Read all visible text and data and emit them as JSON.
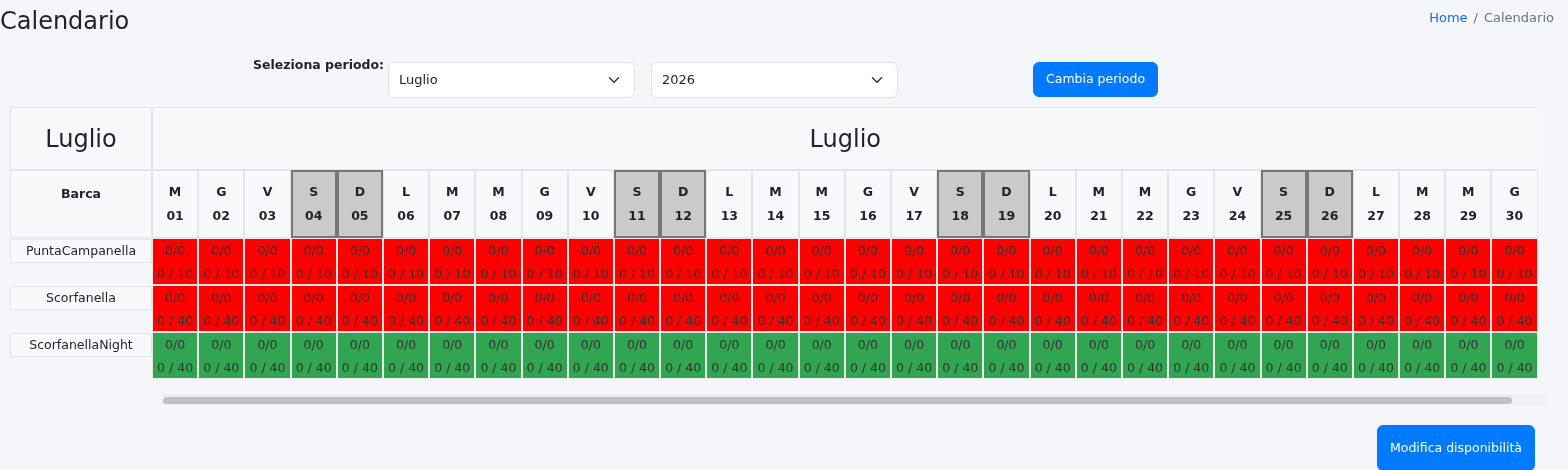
{
  "page_title": "Calendario",
  "breadcrumb": {
    "items": [
      {
        "label": "Home",
        "link": true
      },
      {
        "label": "Calendario",
        "link": false
      }
    ],
    "separator": "/"
  },
  "period": {
    "label": "Seleziona periodo:",
    "month": "Luglio",
    "year": "2026",
    "button": "Cambia periodo"
  },
  "calendar": {
    "corner_title": "Luglio",
    "month_title": "Luglio",
    "boat_header": "Barca",
    "days": [
      {
        "weekday": "M",
        "day": "01",
        "weekend": false
      },
      {
        "weekday": "G",
        "day": "02",
        "weekend": false
      },
      {
        "weekday": "V",
        "day": "03",
        "weekend": false
      },
      {
        "weekday": "S",
        "day": "04",
        "weekend": true
      },
      {
        "weekday": "D",
        "day": "05",
        "weekend": true
      },
      {
        "weekday": "L",
        "day": "06",
        "weekend": false
      },
      {
        "weekday": "M",
        "day": "07",
        "weekend": false
      },
      {
        "weekday": "M",
        "day": "08",
        "weekend": false
      },
      {
        "weekday": "G",
        "day": "09",
        "weekend": false
      },
      {
        "weekday": "V",
        "day": "10",
        "weekend": false
      },
      {
        "weekday": "S",
        "day": "11",
        "weekend": true
      },
      {
        "weekday": "D",
        "day": "12",
        "weekend": true
      },
      {
        "weekday": "L",
        "day": "13",
        "weekend": false
      },
      {
        "weekday": "M",
        "day": "14",
        "weekend": false
      },
      {
        "weekday": "M",
        "day": "15",
        "weekend": false
      },
      {
        "weekday": "G",
        "day": "16",
        "weekend": false
      },
      {
        "weekday": "V",
        "day": "17",
        "weekend": false
      },
      {
        "weekday": "S",
        "day": "18",
        "weekend": true
      },
      {
        "weekday": "D",
        "day": "19",
        "weekend": true
      },
      {
        "weekday": "L",
        "day": "20",
        "weekend": false
      },
      {
        "weekday": "M",
        "day": "21",
        "weekend": false
      },
      {
        "weekday": "M",
        "day": "22",
        "weekend": false
      },
      {
        "weekday": "G",
        "day": "23",
        "weekend": false
      },
      {
        "weekday": "V",
        "day": "24",
        "weekend": false
      },
      {
        "weekday": "S",
        "day": "25",
        "weekend": true
      },
      {
        "weekday": "D",
        "day": "26",
        "weekend": true
      },
      {
        "weekday": "L",
        "day": "27",
        "weekend": false
      },
      {
        "weekday": "M",
        "day": "28",
        "weekend": false
      },
      {
        "weekday": "M",
        "day": "29",
        "weekend": false
      },
      {
        "weekday": "G",
        "day": "30",
        "weekend": false
      }
    ],
    "boats": [
      {
        "name": "PuntaCampanella",
        "color": "#ff0000",
        "booked": [
          "0/0",
          "0/0",
          "0/0",
          "0/0",
          "0/0",
          "0/0",
          "0/0",
          "0/0",
          "0/0",
          "0/0",
          "0/0",
          "0/0",
          "0/0",
          "0/0",
          "0/0",
          "0/0",
          "0/0",
          "0/0",
          "0/0",
          "0/0",
          "0/0",
          "0/0",
          "0/0",
          "0/0",
          "0/0",
          "0/0",
          "0/0",
          "0/0",
          "0/0",
          "0/0"
        ],
        "capacity": [
          "0 / 10",
          "0 / 10",
          "0 / 10",
          "0 / 10",
          "0 / 10",
          "0 / 10",
          "0 / 10",
          "0 / 10",
          "0 / 10",
          "0 / 10",
          "0 / 10",
          "0 / 10",
          "0 / 10",
          "0 / 10",
          "0 / 10",
          "0 / 10",
          "0 / 10",
          "0 / 10",
          "0 / 10",
          "0 / 10",
          "0 / 10",
          "0 / 10",
          "0 / 10",
          "0 / 10",
          "0 / 10",
          "0 / 10",
          "0 / 10",
          "0 / 10",
          "0 / 10",
          "0 / 10"
        ]
      },
      {
        "name": "Scorfanella",
        "color": "#ff0000",
        "booked": [
          "0/0",
          "0/0",
          "0/0",
          "0/0",
          "0/0",
          "0/0",
          "0/0",
          "0/0",
          "0/0",
          "0/0",
          "0/0",
          "0/0",
          "0/0",
          "0/0",
          "0/0",
          "0/0",
          "0/0",
          "0/0",
          "0/0",
          "0/0",
          "0/0",
          "0/0",
          "0/0",
          "0/0",
          "0/0",
          "0/0",
          "0/0",
          "0/0",
          "0/0",
          "0/0"
        ],
        "capacity": [
          "0 / 40",
          "0 / 40",
          "0 / 40",
          "0 / 40",
          "0 / 40",
          "0 / 40",
          "0 / 40",
          "0 / 40",
          "0 / 40",
          "0 / 40",
          "0 / 40",
          "0 / 40",
          "0 / 40",
          "0 / 40",
          "0 / 40",
          "0 / 40",
          "0 / 40",
          "0 / 40",
          "0 / 40",
          "0 / 40",
          "0 / 40",
          "0 / 40",
          "0 / 40",
          "0 / 40",
          "0 / 40",
          "0 / 40",
          "0 / 40",
          "0 / 40",
          "0 / 40",
          "0 / 40"
        ]
      },
      {
        "name": "ScorfanellaNight",
        "color": "#31a552",
        "booked": [
          "0/0",
          "0/0",
          "0/0",
          "0/0",
          "0/0",
          "0/0",
          "0/0",
          "0/0",
          "0/0",
          "0/0",
          "0/0",
          "0/0",
          "0/0",
          "0/0",
          "0/0",
          "0/0",
          "0/0",
          "0/0",
          "0/0",
          "0/0",
          "0/0",
          "0/0",
          "0/0",
          "0/0",
          "0/0",
          "0/0",
          "0/0",
          "0/0",
          "0/0",
          "0/0"
        ],
        "capacity": [
          "0 / 40",
          "0 / 40",
          "0 / 40",
          "0 / 40",
          "0 / 40",
          "0 / 40",
          "0 / 40",
          "0 / 40",
          "0 / 40",
          "0 / 40",
          "0 / 40",
          "0 / 40",
          "0 / 40",
          "0 / 40",
          "0 / 40",
          "0 / 40",
          "0 / 40",
          "0 / 40",
          "0 / 40",
          "0 / 40",
          "0 / 40",
          "0 / 40",
          "0 / 40",
          "0 / 40",
          "0 / 40",
          "0 / 40",
          "0 / 40",
          "0 / 40",
          "0 / 40",
          "0 / 40"
        ]
      }
    ]
  },
  "save_button": "Modifica disponibilità"
}
